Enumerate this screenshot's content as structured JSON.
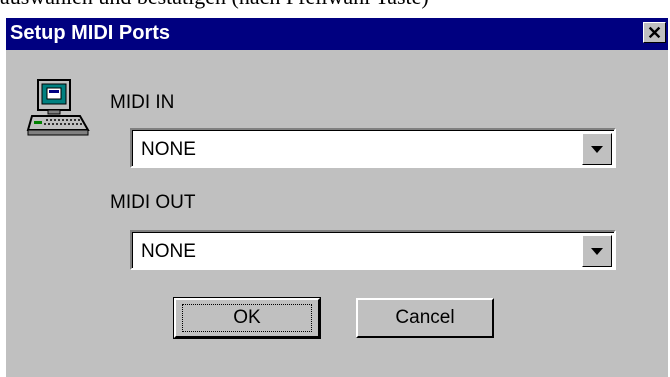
{
  "background_text": "auswählen und bestätigen (nach Pfeilwahl Taste)",
  "dialog": {
    "title": "Setup MIDI Ports",
    "close_glyph": "✕",
    "icon": "computer-icon"
  },
  "midi_in": {
    "label": "MIDI IN",
    "value": "NONE"
  },
  "midi_out": {
    "label": "MIDI OUT",
    "value": "NONE"
  },
  "buttons": {
    "ok": "OK",
    "cancel": "Cancel"
  },
  "colors": {
    "titlebar": "#000080",
    "face": "#c0c0c0",
    "field": "#ffffff"
  }
}
